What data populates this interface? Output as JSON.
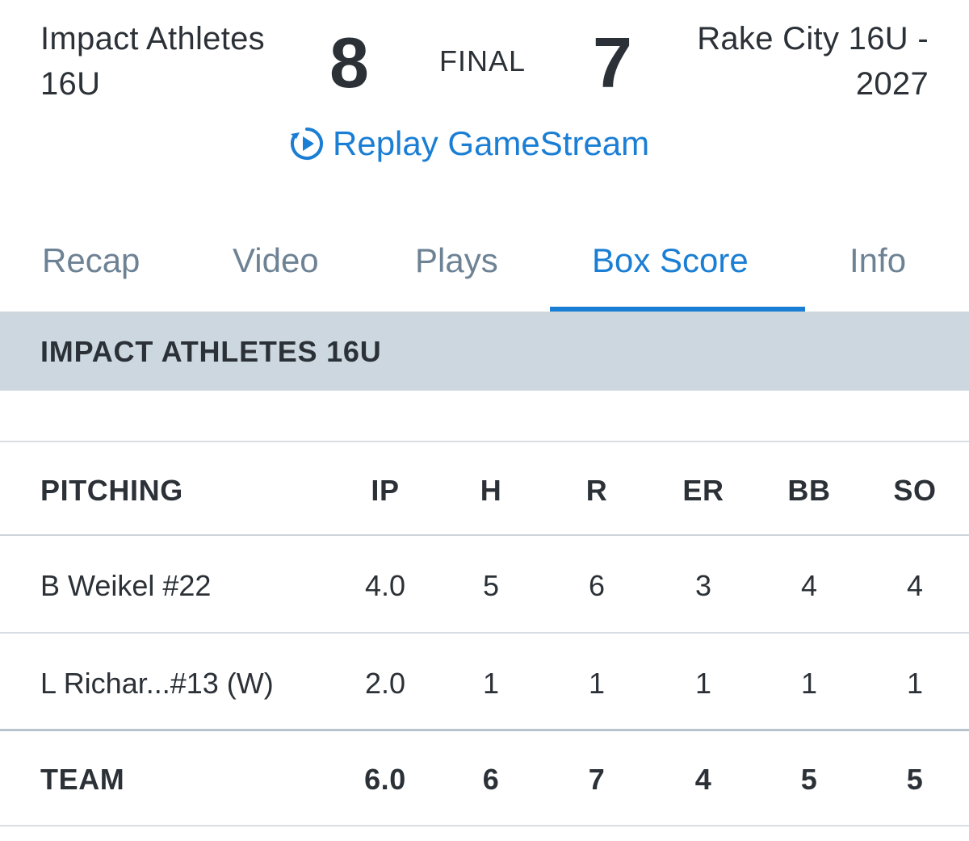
{
  "game": {
    "home_team": "Impact Athletes 16U",
    "home_score": "8",
    "status": "FINAL",
    "away_score": "7",
    "away_team": "Rake City 16U - 2027",
    "replay_label": "Replay GameStream",
    "replay_icon": "replay-play-icon"
  },
  "tabs": [
    {
      "label": "Recap",
      "active": false
    },
    {
      "label": "Video",
      "active": false
    },
    {
      "label": "Plays",
      "active": false
    },
    {
      "label": "Box Score",
      "active": true
    },
    {
      "label": "Info",
      "active": false
    }
  ],
  "team_bar": {
    "label": "IMPACT ATHLETES 16U"
  },
  "pitching": {
    "headers": [
      "PITCHING",
      "IP",
      "H",
      "R",
      "ER",
      "BB",
      "SO"
    ],
    "rows": [
      {
        "name": "B Weikel #22",
        "ip": "4.0",
        "h": "5",
        "r": "6",
        "er": "3",
        "bb": "4",
        "so": "4"
      },
      {
        "name": "L Richar...#13 (W)",
        "ip": "2.0",
        "h": "1",
        "r": "1",
        "er": "1",
        "bb": "1",
        "so": "1"
      }
    ],
    "team": {
      "name": "TEAM",
      "ip": "6.0",
      "h": "6",
      "r": "7",
      "er": "4",
      "bb": "5",
      "so": "5"
    }
  },
  "colors": {
    "accent": "#1a7ed4",
    "text": "#2b3137",
    "tab_inactive": "#6d8294",
    "team_bar_bg": "#ccd7df"
  }
}
